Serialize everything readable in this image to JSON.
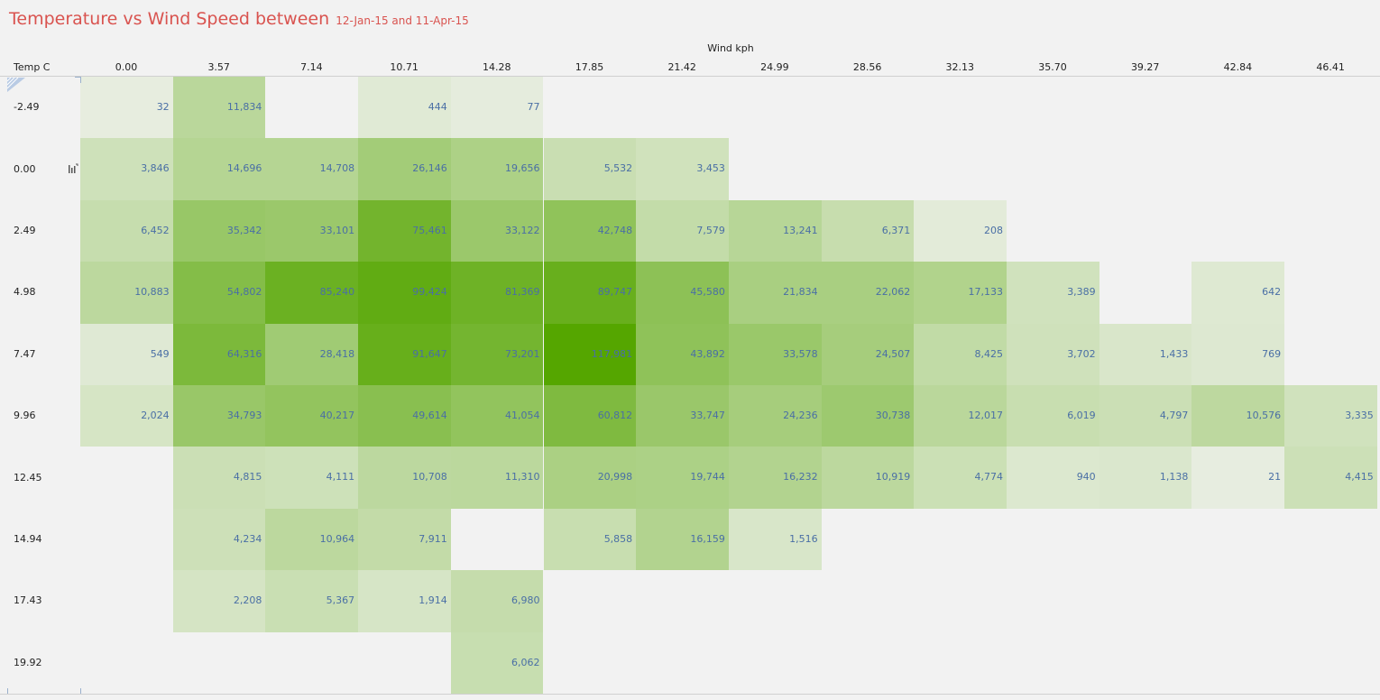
{
  "header": {
    "title": "Temperature vs Wind Speed between",
    "subtitle": "12-Jan-15 and 11-Apr-15"
  },
  "icons": {
    "corner": "corner-triangle-icon",
    "row_action": "column-chart-icon"
  },
  "colors": {
    "title": "#d9534f",
    "value_text": "#4a6fa5",
    "heat_low": "#e9eee3",
    "heat_high": "#55a600",
    "background": "#f2f2f2"
  },
  "chart_data": {
    "type": "heatmap",
    "xlabel": "Wind kph",
    "ylabel": "Temp C",
    "x_categories": [
      "0.00",
      "3.57",
      "7.14",
      "10.71",
      "14.28",
      "17.85",
      "21.42",
      "24.99",
      "28.56",
      "32.13",
      "35.70",
      "39.27",
      "42.84",
      "46.41"
    ],
    "y_categories": [
      "-2.49",
      "0.00",
      "2.49",
      "4.98",
      "7.47",
      "9.96",
      "12.45",
      "14.94",
      "17.43",
      "19.92"
    ],
    "values": [
      [
        32,
        11834,
        null,
        444,
        77,
        null,
        null,
        null,
        null,
        null,
        null,
        null,
        null,
        null
      ],
      [
        3846,
        14696,
        14708,
        26146,
        19656,
        5532,
        3453,
        null,
        null,
        null,
        null,
        null,
        null,
        null
      ],
      [
        6452,
        35342,
        33101,
        75461,
        33122,
        42748,
        7579,
        13241,
        6371,
        208,
        null,
        null,
        null,
        null
      ],
      [
        10883,
        54802,
        85240,
        99424,
        81369,
        89747,
        45580,
        21834,
        22062,
        17133,
        3389,
        null,
        642,
        null
      ],
      [
        549,
        64316,
        28418,
        91647,
        73201,
        117981,
        43892,
        33578,
        24507,
        8425,
        3702,
        1433,
        769,
        null
      ],
      [
        2024,
        34793,
        40217,
        49614,
        41054,
        60812,
        33747,
        24236,
        30738,
        12017,
        6019,
        4797,
        10576,
        3335
      ],
      [
        null,
        4815,
        4111,
        10708,
        11310,
        20998,
        19744,
        16232,
        10919,
        4774,
        940,
        1138,
        21,
        4415
      ],
      [
        null,
        4234,
        10964,
        7911,
        null,
        5858,
        16159,
        1516,
        null,
        null,
        null,
        null,
        null,
        null
      ],
      [
        null,
        2208,
        5367,
        1914,
        6980,
        null,
        null,
        null,
        null,
        null,
        null,
        null,
        null,
        null
      ],
      [
        null,
        null,
        null,
        null,
        6062,
        null,
        null,
        null,
        null,
        null,
        null,
        null,
        null,
        null
      ]
    ],
    "labels": [
      [
        "32",
        "11,834",
        "",
        "444",
        "77",
        "",
        "",
        "",
        "",
        "",
        "",
        "",
        "",
        ""
      ],
      [
        "3,846",
        "14,696",
        "14,708",
        "26,146",
        "19,656",
        "5,532",
        "3,453",
        "",
        "",
        "",
        "",
        "",
        "",
        ""
      ],
      [
        "6,452",
        "35,342",
        "33,101",
        "75,461",
        "33,122",
        "42,748",
        "7,579",
        "13,241",
        "6,371",
        "208",
        "",
        "",
        "",
        ""
      ],
      [
        "10,883",
        "54,802",
        "85,240",
        "99,424",
        "81,369",
        "89,747",
        "45,580",
        "21,834",
        "22,062",
        "17,133",
        "3,389",
        "",
        "642",
        ""
      ],
      [
        "549",
        "64,316",
        "28,418",
        "91,647",
        "73,201",
        "117,981",
        "43,892",
        "33,578",
        "24,507",
        "8,425",
        "3,702",
        "1,433",
        "769",
        ""
      ],
      [
        "2,024",
        "34,793",
        "40,217",
        "49,614",
        "41,054",
        "60,812",
        "33,747",
        "24,236",
        "30,738",
        "12,017",
        "6,019",
        "4,797",
        "10,576",
        "3,335"
      ],
      [
        "",
        "4,815",
        "4,111",
        "10,708",
        "11,310",
        "20,998",
        "19,744",
        "16,232",
        "10,919",
        "4,774",
        "940",
        "1,138",
        "21",
        "4,415"
      ],
      [
        "",
        "4,234",
        "10,964",
        "7,911",
        "",
        "5,858",
        "16,159",
        "1,516",
        "",
        "",
        "",
        "",
        "",
        ""
      ],
      [
        "",
        "2,208",
        "5,367",
        "1,914",
        "6,980",
        "",
        "",
        "",
        "",
        "",
        "",
        "",
        "",
        ""
      ],
      [
        "",
        "",
        "",
        "",
        "6,062",
        "",
        "",
        "",
        "",
        "",
        "",
        "",
        "",
        ""
      ]
    ],
    "vmax": 117981
  }
}
